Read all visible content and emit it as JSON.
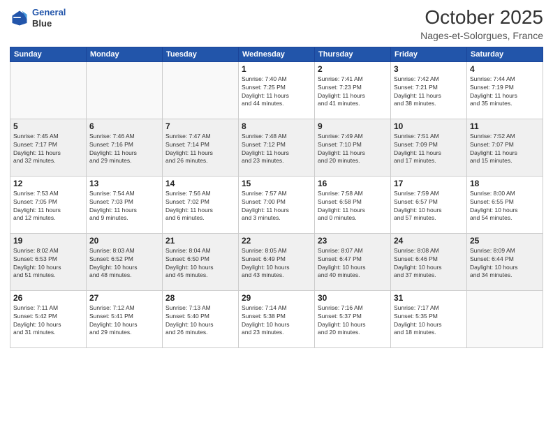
{
  "header": {
    "logo_line1": "General",
    "logo_line2": "Blue",
    "month": "October 2025",
    "location": "Nages-et-Solorgues, France"
  },
  "weekdays": [
    "Sunday",
    "Monday",
    "Tuesday",
    "Wednesday",
    "Thursday",
    "Friday",
    "Saturday"
  ],
  "weeks": [
    [
      {
        "day": "",
        "info": ""
      },
      {
        "day": "",
        "info": ""
      },
      {
        "day": "",
        "info": ""
      },
      {
        "day": "1",
        "info": "Sunrise: 7:40 AM\nSunset: 7:25 PM\nDaylight: 11 hours\nand 44 minutes."
      },
      {
        "day": "2",
        "info": "Sunrise: 7:41 AM\nSunset: 7:23 PM\nDaylight: 11 hours\nand 41 minutes."
      },
      {
        "day": "3",
        "info": "Sunrise: 7:42 AM\nSunset: 7:21 PM\nDaylight: 11 hours\nand 38 minutes."
      },
      {
        "day": "4",
        "info": "Sunrise: 7:44 AM\nSunset: 7:19 PM\nDaylight: 11 hours\nand 35 minutes."
      }
    ],
    [
      {
        "day": "5",
        "info": "Sunrise: 7:45 AM\nSunset: 7:17 PM\nDaylight: 11 hours\nand 32 minutes."
      },
      {
        "day": "6",
        "info": "Sunrise: 7:46 AM\nSunset: 7:16 PM\nDaylight: 11 hours\nand 29 minutes."
      },
      {
        "day": "7",
        "info": "Sunrise: 7:47 AM\nSunset: 7:14 PM\nDaylight: 11 hours\nand 26 minutes."
      },
      {
        "day": "8",
        "info": "Sunrise: 7:48 AM\nSunset: 7:12 PM\nDaylight: 11 hours\nand 23 minutes."
      },
      {
        "day": "9",
        "info": "Sunrise: 7:49 AM\nSunset: 7:10 PM\nDaylight: 11 hours\nand 20 minutes."
      },
      {
        "day": "10",
        "info": "Sunrise: 7:51 AM\nSunset: 7:09 PM\nDaylight: 11 hours\nand 17 minutes."
      },
      {
        "day": "11",
        "info": "Sunrise: 7:52 AM\nSunset: 7:07 PM\nDaylight: 11 hours\nand 15 minutes."
      }
    ],
    [
      {
        "day": "12",
        "info": "Sunrise: 7:53 AM\nSunset: 7:05 PM\nDaylight: 11 hours\nand 12 minutes."
      },
      {
        "day": "13",
        "info": "Sunrise: 7:54 AM\nSunset: 7:03 PM\nDaylight: 11 hours\nand 9 minutes."
      },
      {
        "day": "14",
        "info": "Sunrise: 7:56 AM\nSunset: 7:02 PM\nDaylight: 11 hours\nand 6 minutes."
      },
      {
        "day": "15",
        "info": "Sunrise: 7:57 AM\nSunset: 7:00 PM\nDaylight: 11 hours\nand 3 minutes."
      },
      {
        "day": "16",
        "info": "Sunrise: 7:58 AM\nSunset: 6:58 PM\nDaylight: 11 hours\nand 0 minutes."
      },
      {
        "day": "17",
        "info": "Sunrise: 7:59 AM\nSunset: 6:57 PM\nDaylight: 10 hours\nand 57 minutes."
      },
      {
        "day": "18",
        "info": "Sunrise: 8:00 AM\nSunset: 6:55 PM\nDaylight: 10 hours\nand 54 minutes."
      }
    ],
    [
      {
        "day": "19",
        "info": "Sunrise: 8:02 AM\nSunset: 6:53 PM\nDaylight: 10 hours\nand 51 minutes."
      },
      {
        "day": "20",
        "info": "Sunrise: 8:03 AM\nSunset: 6:52 PM\nDaylight: 10 hours\nand 48 minutes."
      },
      {
        "day": "21",
        "info": "Sunrise: 8:04 AM\nSunset: 6:50 PM\nDaylight: 10 hours\nand 45 minutes."
      },
      {
        "day": "22",
        "info": "Sunrise: 8:05 AM\nSunset: 6:49 PM\nDaylight: 10 hours\nand 43 minutes."
      },
      {
        "day": "23",
        "info": "Sunrise: 8:07 AM\nSunset: 6:47 PM\nDaylight: 10 hours\nand 40 minutes."
      },
      {
        "day": "24",
        "info": "Sunrise: 8:08 AM\nSunset: 6:46 PM\nDaylight: 10 hours\nand 37 minutes."
      },
      {
        "day": "25",
        "info": "Sunrise: 8:09 AM\nSunset: 6:44 PM\nDaylight: 10 hours\nand 34 minutes."
      }
    ],
    [
      {
        "day": "26",
        "info": "Sunrise: 7:11 AM\nSunset: 5:42 PM\nDaylight: 10 hours\nand 31 minutes."
      },
      {
        "day": "27",
        "info": "Sunrise: 7:12 AM\nSunset: 5:41 PM\nDaylight: 10 hours\nand 29 minutes."
      },
      {
        "day": "28",
        "info": "Sunrise: 7:13 AM\nSunset: 5:40 PM\nDaylight: 10 hours\nand 26 minutes."
      },
      {
        "day": "29",
        "info": "Sunrise: 7:14 AM\nSunset: 5:38 PM\nDaylight: 10 hours\nand 23 minutes."
      },
      {
        "day": "30",
        "info": "Sunrise: 7:16 AM\nSunset: 5:37 PM\nDaylight: 10 hours\nand 20 minutes."
      },
      {
        "day": "31",
        "info": "Sunrise: 7:17 AM\nSunset: 5:35 PM\nDaylight: 10 hours\nand 18 minutes."
      },
      {
        "day": "",
        "info": ""
      }
    ]
  ]
}
